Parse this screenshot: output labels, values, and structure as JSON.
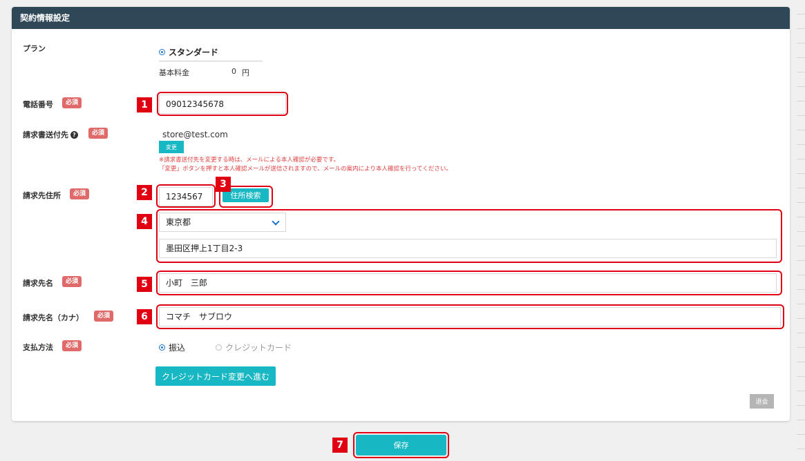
{
  "panel": {
    "title": "契約情報設定"
  },
  "plan": {
    "label": "プラン",
    "option": "スタンダード",
    "fee_label": "基本料金",
    "fee_value": "0",
    "fee_unit": "円"
  },
  "required_badge": "必須",
  "phone": {
    "label": "電話番号",
    "value": "09012345678"
  },
  "invoice_email": {
    "label": "請求書送付先",
    "value": "store@test.com",
    "change_button": "変更",
    "note1": "※請求書送付先を変更する時は、メールによる本人確認が必要です。",
    "note2": "「変更」ボタンを押すと本人確認メールが送信されますので、メールの案内により本人確認を行ってください。"
  },
  "address": {
    "label": "請求先住所",
    "zip": "1234567",
    "search_button": "住所検索",
    "prefecture": "東京都",
    "street": "墨田区押上1丁目2-3"
  },
  "billing_name": {
    "label": "請求先名",
    "value": "小町　三郎"
  },
  "billing_kana": {
    "label": "請求先名（カナ）",
    "value": "コマチ　サブロウ"
  },
  "payment": {
    "label": "支払方法",
    "option_transfer": "振込",
    "option_card": "クレジットカード",
    "card_button": "クレジットカード変更へ進む"
  },
  "withdraw_button": "退会",
  "save_button": "保存",
  "markers": [
    "1",
    "2",
    "3",
    "4",
    "5",
    "6",
    "7"
  ],
  "colors": {
    "header": "#2f4858",
    "accent": "#17b7c3",
    "required": "#e06a6a",
    "highlight": "#e00012",
    "note": "#e04040"
  }
}
